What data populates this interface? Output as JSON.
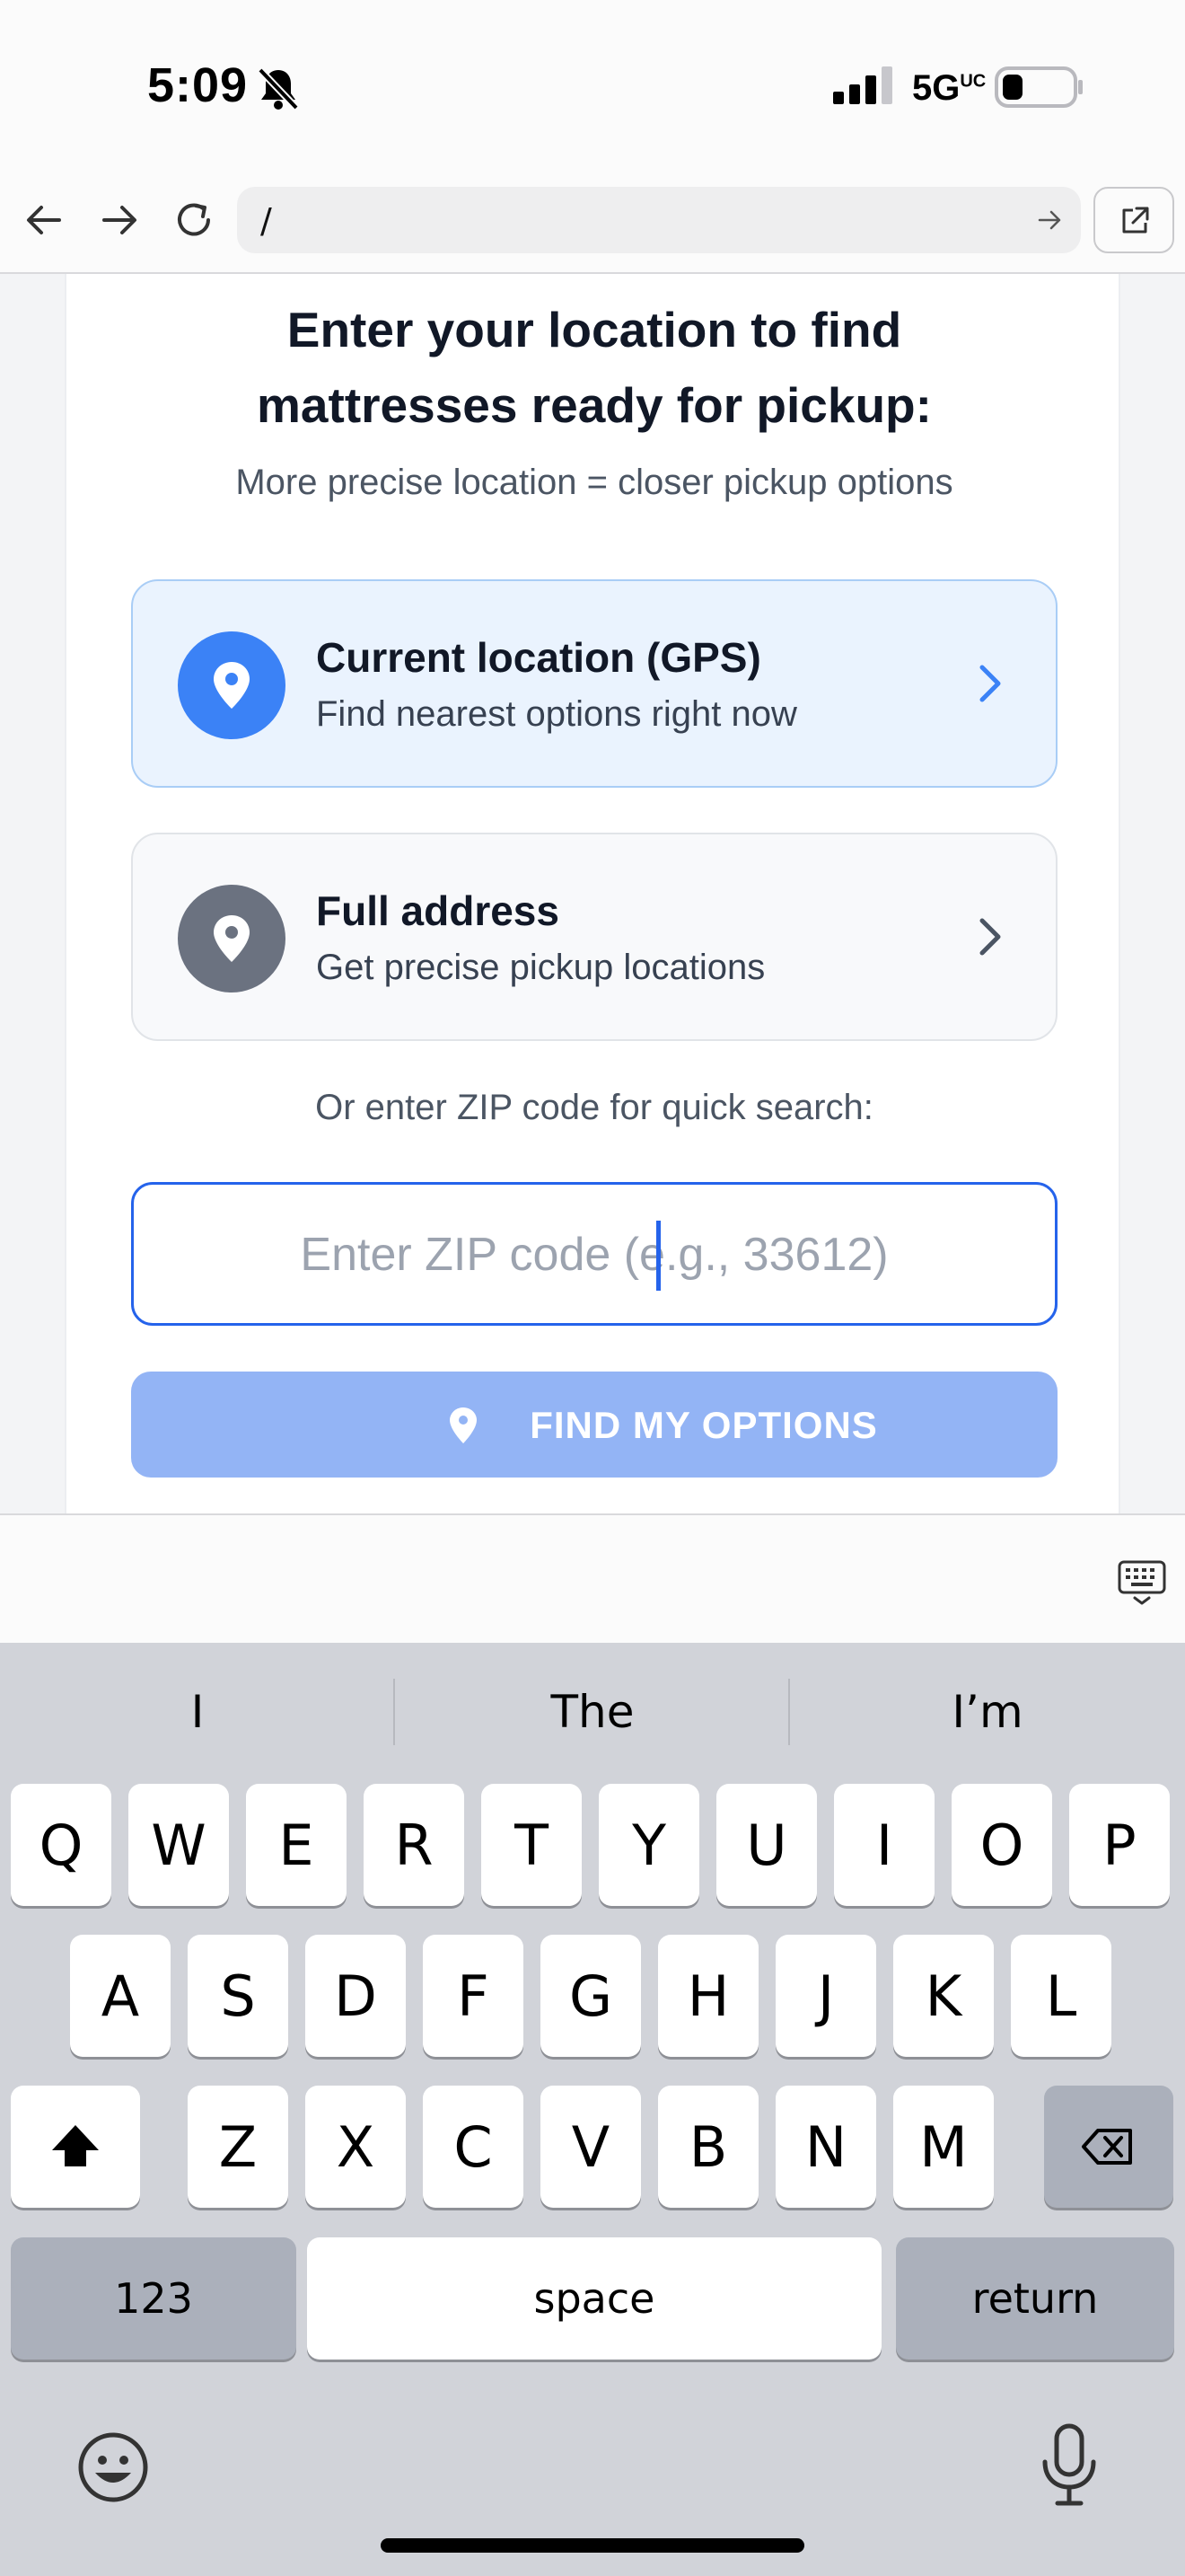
{
  "status_bar": {
    "time": "5:09",
    "network": "5G",
    "network_suffix": "UC"
  },
  "browser": {
    "url": "/"
  },
  "page": {
    "heading_line1": "Enter your location to find",
    "heading_line2": "mattresses ready for pickup:",
    "subheading": "More precise location = closer pickup options",
    "options": [
      {
        "title": "Current location (GPS)",
        "description": "Find nearest options right now"
      },
      {
        "title": "Full address",
        "description": "Get precise pickup locations"
      }
    ],
    "zip_prompt": "Or enter ZIP code for quick search:",
    "zip_input": {
      "placeholder": "Enter ZIP code (e.g., 33612)",
      "value": ""
    },
    "find_button": "FIND MY OPTIONS",
    "colors": {
      "accent": "#3b82f6",
      "button_disabled": "#93b4f5",
      "gps_card_bg": "#eaf3fe"
    }
  },
  "keyboard": {
    "suggestions": [
      "I",
      "The",
      "I’m"
    ],
    "row1": [
      "Q",
      "W",
      "E",
      "R",
      "T",
      "Y",
      "U",
      "I",
      "O",
      "P"
    ],
    "row2": [
      "A",
      "S",
      "D",
      "F",
      "G",
      "H",
      "J",
      "K",
      "L"
    ],
    "row3": [
      "Z",
      "X",
      "C",
      "V",
      "B",
      "N",
      "M"
    ],
    "numbers_key": "123",
    "space_key": "space",
    "return_key": "return",
    "icons": {
      "shift": "shift-icon",
      "delete": "backspace-icon",
      "emoji": "emoji-icon",
      "mic": "microphone-icon",
      "dismiss": "keyboard-dismiss-icon"
    }
  }
}
